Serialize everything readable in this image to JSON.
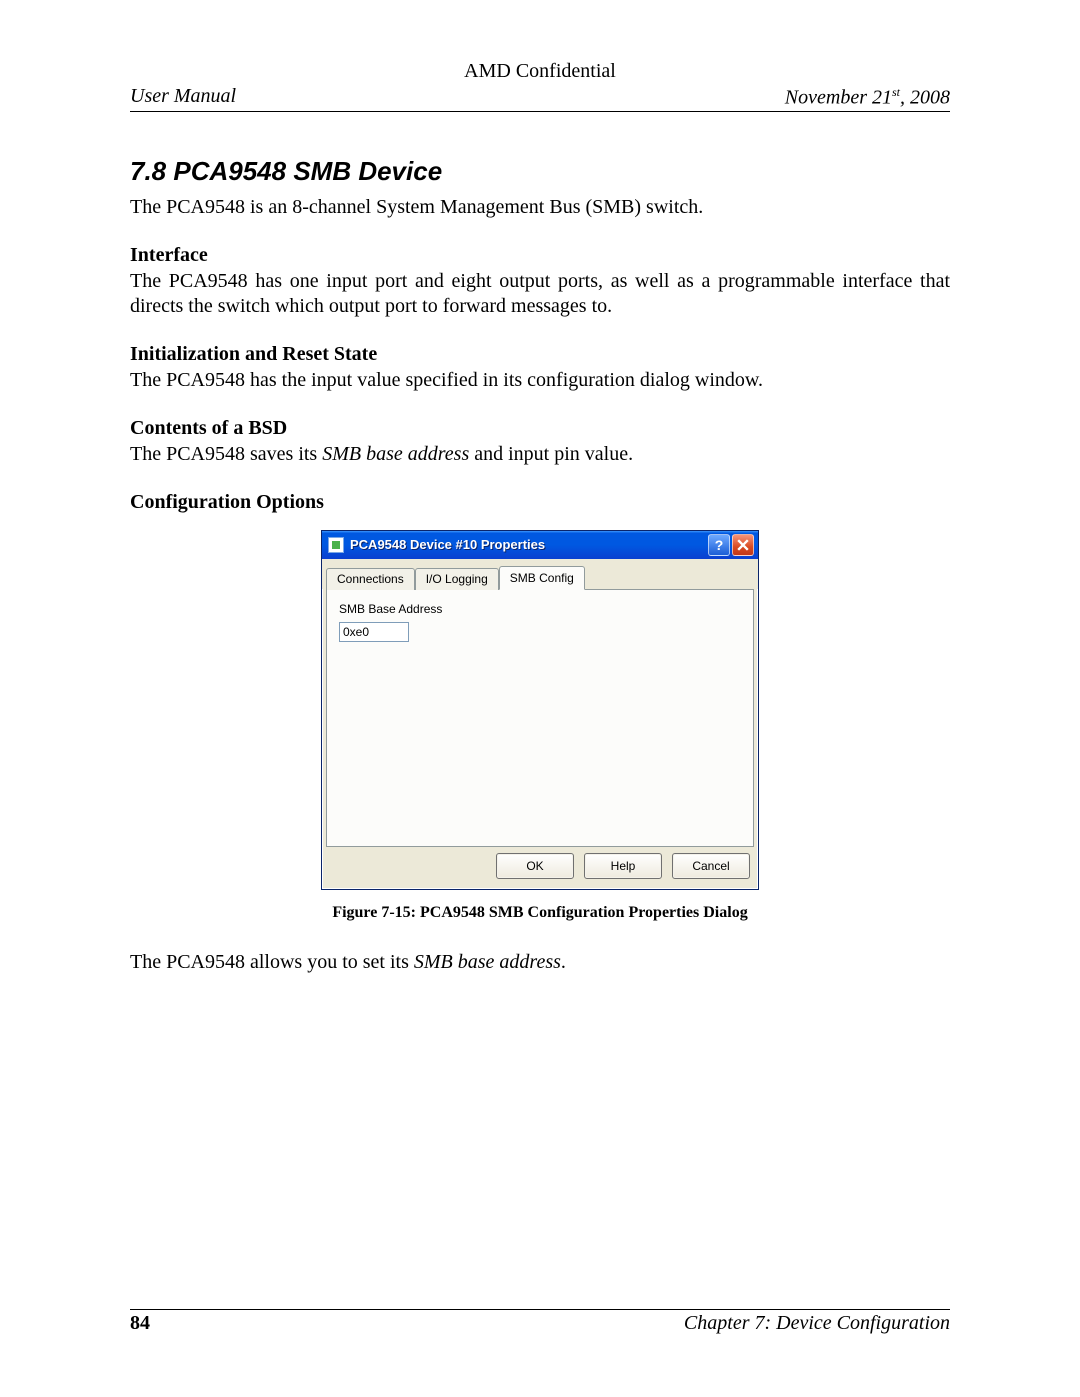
{
  "header": {
    "confidential": "AMD Confidential",
    "left": "User Manual",
    "date_prefix": "November 21",
    "date_suffix": "st",
    "date_year": ", 2008"
  },
  "section": {
    "number_title": "7.8  PCA9548 SMB Device",
    "intro": "The PCA9548 is an 8-channel System Management Bus (SMB) switch.",
    "interface_head": "Interface",
    "interface_body": "The PCA9548 has one input port and eight output ports, as well as a programmable interface that directs the switch which output port to forward messages to.",
    "init_head": "Initialization and Reset State",
    "init_body": "The PCA9548 has the input value specified in its configuration dialog window.",
    "bsd_head": "Contents of a BSD",
    "bsd_body_pre": "The PCA9548 saves its ",
    "bsd_body_em": "SMB base address",
    "bsd_body_post": " and input pin value.",
    "config_head": "Configuration Options",
    "after_fig_pre": "The PCA9548 allows you to set its ",
    "after_fig_em": "SMB base address",
    "after_fig_post": "."
  },
  "dialog": {
    "title": "PCA9548 Device #10 Properties",
    "help_symbol": "?",
    "tabs": {
      "connections": "Connections",
      "io_logging": "I/O Logging",
      "smb_config": "SMB Config"
    },
    "panel": {
      "label": "SMB Base Address",
      "value": "0xe0"
    },
    "buttons": {
      "ok": "OK",
      "help": "Help",
      "cancel": "Cancel"
    }
  },
  "figure_caption": "Figure 7-15: PCA9548 SMB Configuration Properties Dialog",
  "footer": {
    "page": "84",
    "chapter": "Chapter 7: Device Configuration"
  }
}
